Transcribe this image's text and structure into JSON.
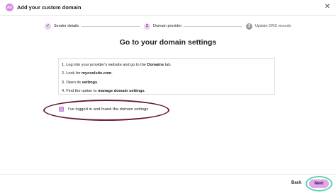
{
  "header": {
    "logo_text": "AD",
    "title": "Add your custom domain",
    "close_icon": "close-icon"
  },
  "stepper": {
    "steps": [
      {
        "marker": "✓",
        "label": "Sender details",
        "state": "completed"
      },
      {
        "marker": "2",
        "label": "Domain provider",
        "state": "current"
      },
      {
        "marker": "3",
        "label": "Update DNS records",
        "state": "upcoming"
      }
    ]
  },
  "main": {
    "heading": "Go to your domain settings",
    "instructions": [
      {
        "prefix": "1. Log into your provider's website and go to the ",
        "bold": "Domains",
        "suffix": " tab."
      },
      {
        "prefix": "2. Look for ",
        "bold": "mycoolsite.com",
        "suffix": "."
      },
      {
        "prefix": "3. Open its ",
        "bold": "settings",
        "suffix": "."
      },
      {
        "prefix": "4. Find the option to ",
        "bold": "manage domain settings",
        "suffix": "."
      }
    ],
    "confirm_checkbox": {
      "label": "I've logged in and found the domain settings",
      "checked": true
    }
  },
  "footer": {
    "back_label": "Back",
    "next_label": "Next"
  },
  "colors": {
    "accent": "#d9a8e3",
    "annotation_ellipse": "#6b1a30",
    "annotation_ring": "#5fd3b0"
  }
}
